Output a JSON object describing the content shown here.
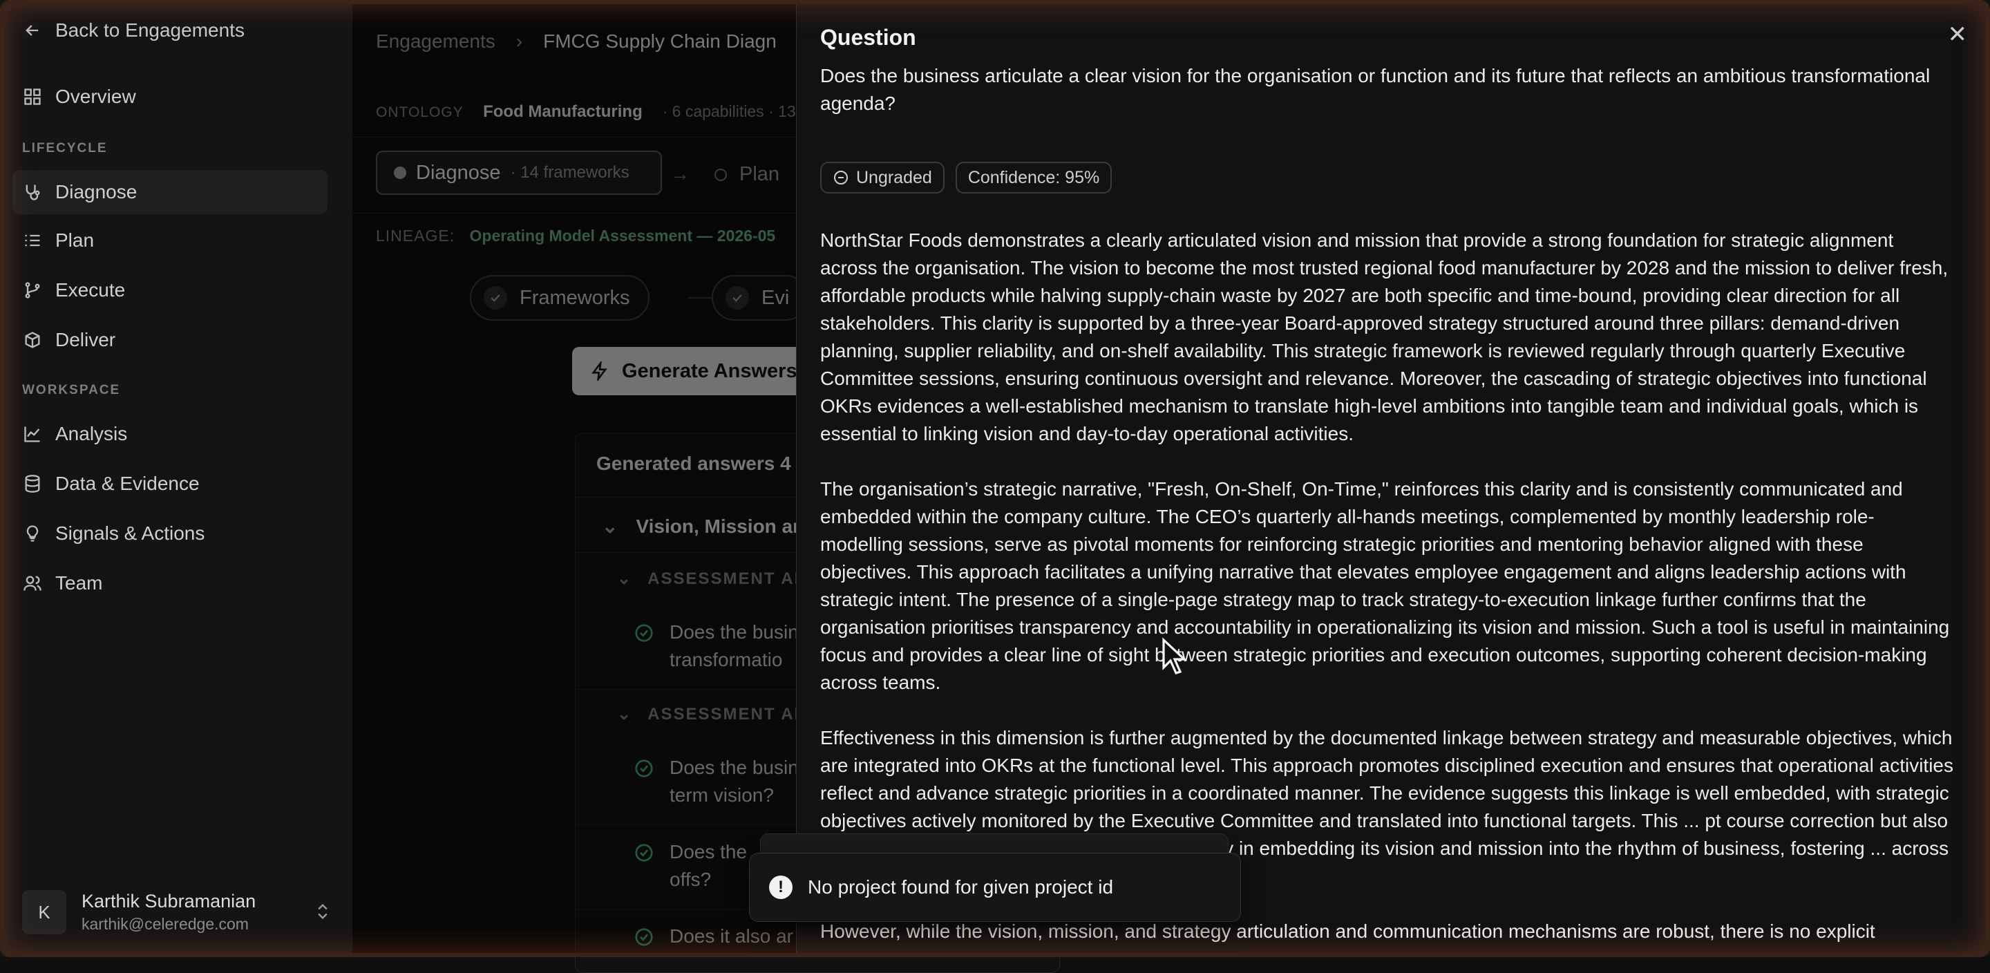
{
  "sidebar": {
    "back_label": "Back to Engagements",
    "overview": "Overview",
    "lifecycle_label": "LIFECYCLE",
    "lifecycle": [
      "Diagnose",
      "Plan",
      "Execute",
      "Deliver"
    ],
    "workspace_label": "WORKSPACE",
    "workspace": [
      "Analysis",
      "Data & Evidence",
      "Signals & Actions",
      "Team"
    ],
    "user": {
      "initial": "K",
      "name": "Karthik Subramanian",
      "email": "karthik@celeredge.com"
    }
  },
  "main": {
    "breadcrumb": [
      "Engagements",
      "FMCG Supply Chain Diagn"
    ],
    "ontology": {
      "label": "ONTOLOGY",
      "name": "Food Manufacturing",
      "meta": "· 6 capabilities · 13"
    },
    "stage": {
      "name": "Diagnose",
      "count": "· 14 frameworks",
      "next": "Plan"
    },
    "lineage": {
      "label": "LINEAGE:",
      "value": "Operating Model Assessment — 2026-05"
    },
    "steps": [
      "Frameworks",
      "Evi"
    ],
    "generate_label": "Generate Answers",
    "generated_header": "Generated answers 4",
    "dimension": "Vision, Mission ar",
    "assessment_label": "ASSESSMENT ARE",
    "questions": [
      "Does the busin",
      "transformatio",
      "Does the busin",
      "term vision?",
      "Does the",
      "offs?",
      "Does it also ar"
    ]
  },
  "drawer": {
    "title": "Question",
    "close_glyph": "✕",
    "question": "Does the business articulate a clear vision for the organisation or function and its future that reflects an ambitious transformational agenda?",
    "grade_badge": "Ungraded",
    "confidence_badge": "Confidence: 95%",
    "paragraphs": [
      "NorthStar Foods demonstrates a clearly articulated vision and mission that provide a strong foundation for strategic alignment across the organisation. The vision to become the most trusted regional food manufacturer by 2028 and the mission to deliver fresh, affordable products while halving supply-chain waste by 2027 are both specific and time-bound, providing clear direction for all stakeholders. This clarity is supported by a three-year Board-approved strategy structured around three pillars: demand-driven planning, supplier reliability, and on-shelf availability. This strategic framework is reviewed regularly through quarterly Executive Committee sessions, ensuring continuous oversight and relevance. Moreover, the cascading of strategic objectives into functional OKRs evidences a well-established mechanism to translate high-level ambitions into tangible team and individual goals, which is essential to linking vision and day-to-day operational activities.",
      "The organisation’s strategic narrative, \"Fresh, On-Shelf, On-Time,\" reinforces this clarity and is consistently communicated and embedded within the company culture. The CEO’s quarterly all-hands meetings, complemented by monthly leadership role-modelling sessions, serve as pivotal moments for reinforcing strategic priorities and mentoring behavior aligned with these objectives. This approach facilitates a unifying narrative that elevates employee engagement and aligns leadership actions with strategic intent. The presence of a single-page strategy map to track strategy-to-execution linkage further confirms that the organisation prioritises transparency and accountability in operationalizing its vision and mission. Such a tool is useful in maintaining focus and provides a clear line of sight between strategic priorities and execution outcomes, supporting coherent decision-making across teams.",
      "Effectiveness in this dimension is further augmented by the documented linkage between strategy and measurable objectives, which are integrated into OKRs at the functional level. This approach promotes disciplined execution and ensures that operational activities reflect and advance strategic priorities in a coordinated manner. The evidence suggests this linkage is well embedded, with strategic objectives actively monitored by the Executive Committee and translated into functional targets. This ... pt course correction but also enhances strategic agility. Therefore, the ... bility in embedding its vision and mission into the rhythm of business, fostering ... across functions.",
      "However, while the vision, mission, and strategy articulation and communication mechanisms are robust, there is no explicit"
    ]
  },
  "toast": {
    "message": "No project found for given project id"
  }
}
